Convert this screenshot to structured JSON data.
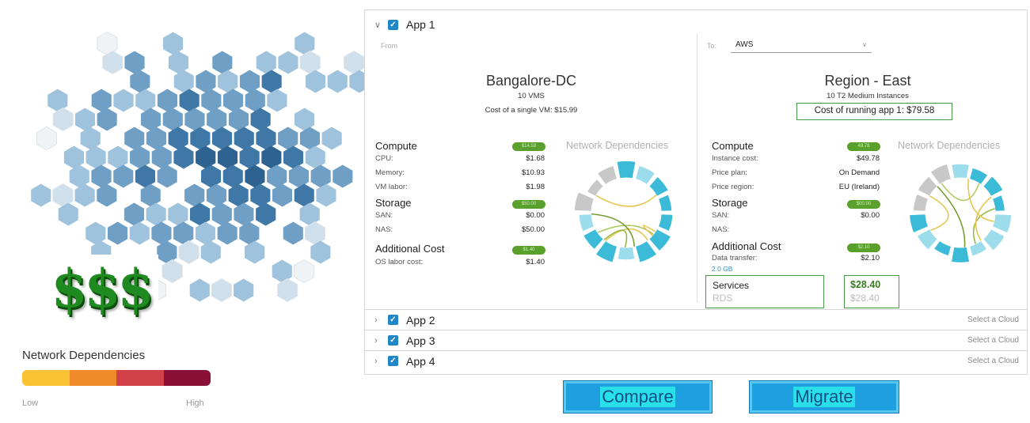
{
  "legend": {
    "title": "Network Dependencies",
    "low": "Low",
    "high": "High",
    "colors": [
      "#f8c234",
      "#f08a2a",
      "#d2404a",
      "#8a1037"
    ]
  },
  "decor": {
    "dollars_text": "$$$"
  },
  "apps": [
    {
      "name": "App 1",
      "expanded": true,
      "checked": true,
      "from": {
        "label": "From",
        "title": "Bangalore-DC",
        "subtitle": "10 VMS",
        "cost_line": "Cost of a single VM: $15.99",
        "compute": {
          "title": "Compute",
          "badge": "$14.59",
          "rows": [
            {
              "label": "CPU:",
              "value": "$1.68"
            },
            {
              "label": "Memory:",
              "value": "$10.93"
            },
            {
              "label": "VM labor:",
              "value": "$1.98"
            }
          ]
        },
        "storage": {
          "title": "Storage",
          "badge": "$50.00",
          "rows": [
            {
              "label": "SAN:",
              "value": "$0.00"
            },
            {
              "label": "NAS:",
              "value": "$50.00"
            }
          ]
        },
        "additional": {
          "title": "Additional Cost",
          "badge": "$1.40",
          "rows": [
            {
              "label": "OS labor cost:",
              "value": "$1.40"
            }
          ]
        },
        "network_title": "Network Dependencies"
      },
      "to": {
        "label": "To:",
        "selected_cloud": "AWS",
        "title": "Region - East",
        "subtitle": "10 T2 Medium Instances",
        "cost_line": "Cost of running app 1: $79.58",
        "compute": {
          "title": "Compute",
          "badge": "49.78",
          "rows": [
            {
              "label": "Instance cost:",
              "value": "$49.78"
            },
            {
              "label": "Price plan:",
              "value": "On Demand"
            },
            {
              "label": "Price region:",
              "value": "EU (Ireland)"
            }
          ]
        },
        "storage": {
          "title": "Storage",
          "badge": "$00.00",
          "rows": [
            {
              "label": "SAN:",
              "value": "$0.00"
            },
            {
              "label": "NAS:",
              "value": ""
            }
          ]
        },
        "additional": {
          "title": "Additional Cost",
          "badge": "$2.10",
          "rows": [
            {
              "label": "Data transfer:",
              "value": "$2.10"
            }
          ],
          "link": "2.0 GB"
        },
        "services": {
          "title": "Services",
          "rds": "RDS",
          "value": "$28.40",
          "rds_value": "$28.40"
        },
        "network_title": "Network Dependencies"
      }
    },
    {
      "name": "App 2",
      "expanded": false,
      "checked": true,
      "status": "Select a Cloud"
    },
    {
      "name": "App 3",
      "expanded": false,
      "checked": true,
      "status": "Select a Cloud"
    },
    {
      "name": "App 4",
      "expanded": false,
      "checked": true,
      "status": "Select a Cloud"
    }
  ],
  "buttons": {
    "compare": "Compare",
    "migrate": "Migrate"
  }
}
